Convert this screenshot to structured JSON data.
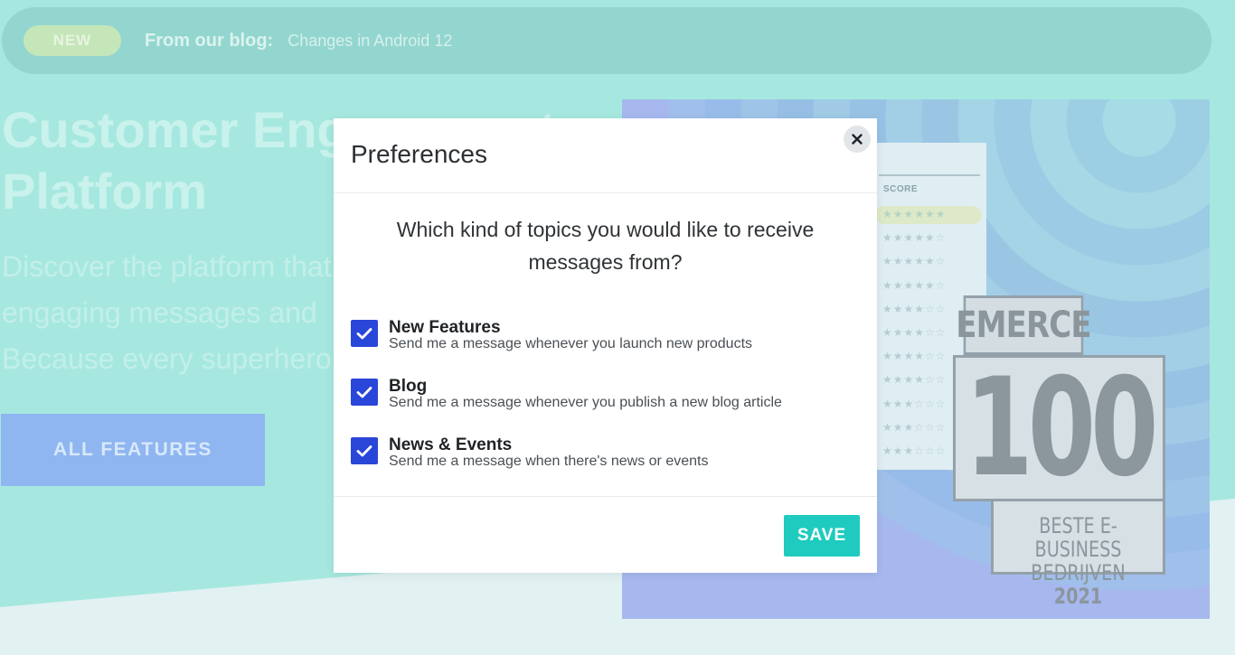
{
  "announcement": {
    "badge": "NEW",
    "from_label": "From our blog:",
    "link_text": "Changes in Android 12"
  },
  "hero": {
    "title_line1": "Customer Engagement",
    "title_line2": "Platform",
    "text_line1": "Discover the platform that",
    "text_line2": "engaging messages and",
    "text_line3": "Because every superhero",
    "button_label": "ALL FEATURES"
  },
  "showcase": {
    "score_label": "SCORE",
    "star_rows": [
      "★★★★★★",
      "★★★★★☆",
      "★★★★★☆",
      "★★★★★☆",
      "★★★★☆☆",
      "★★★★☆☆",
      "★★★★☆☆",
      "★★★★☆☆",
      "★★★☆☆☆",
      "★★★☆☆☆",
      "★★★☆☆☆"
    ],
    "award_name": "EMERCE",
    "award_number": "100",
    "award_line1": "BESTE E-BUSINESS",
    "award_line2": "BEDRIJVEN",
    "award_year": "2021"
  },
  "modal": {
    "title": "Preferences",
    "close_label": "×",
    "question": "Which kind of topics you would like to receive messages from?",
    "options": [
      {
        "title": "New Features",
        "description": "Send me a message whenever you launch new products",
        "checked": true
      },
      {
        "title": "Blog",
        "description": "Send me a message whenever you publish a new blog article",
        "checked": true
      },
      {
        "title": "News & Events",
        "description": "Send me a message when there's news or events",
        "checked": true
      }
    ],
    "save_label": "SAVE"
  },
  "colors": {
    "accent": "#1fcbbf",
    "checkbox": "#2a46d8",
    "page_bg": "#a6e8e0"
  }
}
